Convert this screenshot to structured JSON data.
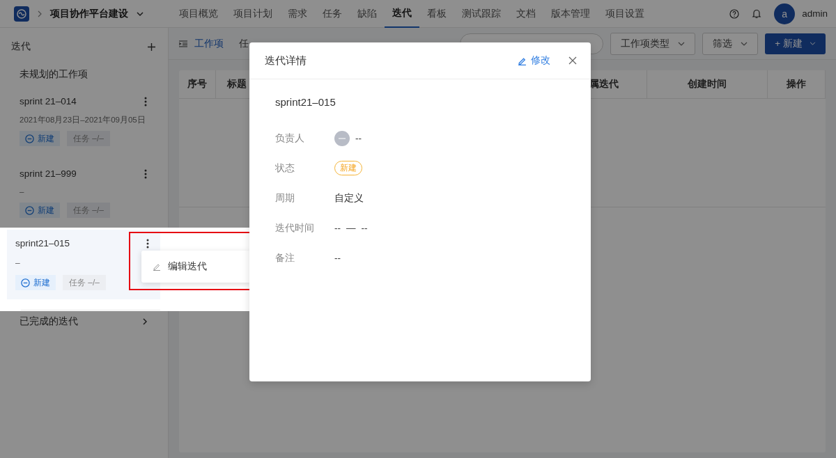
{
  "header": {
    "project": "项目协作平台建设",
    "nav": [
      {
        "label": "项目概览",
        "selected": false
      },
      {
        "label": "项目计划",
        "selected": false
      },
      {
        "label": "需求",
        "selected": false
      },
      {
        "label": "任务",
        "selected": false
      },
      {
        "label": "缺陷",
        "selected": false
      },
      {
        "label": "迭代",
        "selected": true
      },
      {
        "label": "看板",
        "selected": false
      },
      {
        "label": "测试跟踪",
        "selected": false
      },
      {
        "label": "文档",
        "selected": false
      },
      {
        "label": "版本管理",
        "selected": false
      },
      {
        "label": "项目设置",
        "selected": false
      }
    ],
    "user": {
      "avatar": "a",
      "name": "admin"
    }
  },
  "sidebar": {
    "title": "迭代",
    "unplanned": "未规划的工作项",
    "items": [
      {
        "name": "sprint 21–014",
        "date": "2021年08月23日–2021年09月05日",
        "status": "新建",
        "tasks": "任务 –/–"
      },
      {
        "name": "sprint 21–999",
        "date": "–",
        "status": "新建",
        "tasks": "任务 –/–"
      },
      {
        "name": "sprint21–015",
        "date": "–",
        "status": "新建",
        "tasks": "任务 –/–",
        "menu": [
          "编辑迭代"
        ]
      }
    ],
    "completed": "已完成的迭代"
  },
  "toolbar": {
    "tabs": [
      {
        "label": "工作项",
        "selected": true
      },
      {
        "label": "任",
        "selected": false
      }
    ],
    "filters": [
      "工作项类型",
      "筛选"
    ],
    "new_button": "+ 新建"
  },
  "table": {
    "columns": [
      "序号",
      "标题",
      "属迭代",
      "创建时间",
      "操作"
    ]
  },
  "dialog": {
    "title": "迭代详情",
    "edit": "修改",
    "name": "sprint21–015",
    "fields": [
      {
        "kind": "user",
        "label": "负责人",
        "value": "--"
      },
      {
        "kind": "status",
        "label": "状态",
        "value": "新建"
      },
      {
        "kind": "text",
        "label": "周期",
        "value": "自定义"
      },
      {
        "kind": "range",
        "label": "迭代时间",
        "start": "--",
        "separator": "—",
        "end": "--"
      },
      {
        "kind": "text",
        "label": "备注",
        "value": "--"
      }
    ]
  }
}
